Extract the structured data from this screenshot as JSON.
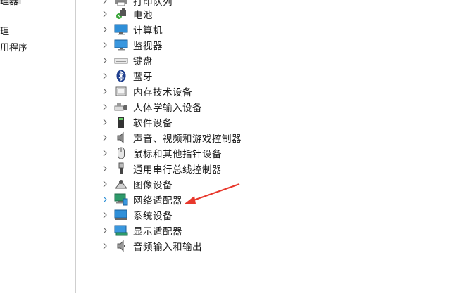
{
  "left_pane": {
    "items": [
      {
        "text": "理器"
      },
      {
        "text": "理"
      },
      {
        "text": "用程序"
      }
    ]
  },
  "tree": {
    "items": [
      {
        "label": "打印队列",
        "icon": "printer-icon",
        "expanded": false
      },
      {
        "label": "电池",
        "icon": "battery-icon",
        "expanded": false
      },
      {
        "label": "计算机",
        "icon": "computer-icon",
        "expanded": false
      },
      {
        "label": "监视器",
        "icon": "monitor-icon",
        "expanded": false
      },
      {
        "label": "键盘",
        "icon": "keyboard-icon",
        "expanded": false
      },
      {
        "label": "蓝牙",
        "icon": "bluetooth-icon",
        "expanded": false
      },
      {
        "label": "内存技术设备",
        "icon": "memory-device-icon",
        "expanded": false
      },
      {
        "label": "人体学输入设备",
        "icon": "hid-icon",
        "expanded": false
      },
      {
        "label": "软件设备",
        "icon": "software-device-icon",
        "expanded": false
      },
      {
        "label": "声音、视频和游戏控制器",
        "icon": "speaker-icon",
        "expanded": false
      },
      {
        "label": "鼠标和其他指针设备",
        "icon": "mouse-icon",
        "expanded": false
      },
      {
        "label": "通用串行总线控制器",
        "icon": "usb-icon",
        "expanded": false
      },
      {
        "label": "图像设备",
        "icon": "camera-icon",
        "expanded": false
      },
      {
        "label": "网络适配器",
        "icon": "network-adapter-icon",
        "expanded": false,
        "hovered": true
      },
      {
        "label": "系统设备",
        "icon": "system-device-icon",
        "expanded": false
      },
      {
        "label": "显示适配器",
        "icon": "display-adapter-icon",
        "expanded": false
      },
      {
        "label": "音频输入和输出",
        "icon": "audio-io-icon",
        "expanded": false
      }
    ]
  },
  "colors": {
    "arrow": "#e8382c",
    "chevron": "#6b6b6b",
    "chevron_hover": "#2b8fd6",
    "divider": "#cfcfcf"
  }
}
